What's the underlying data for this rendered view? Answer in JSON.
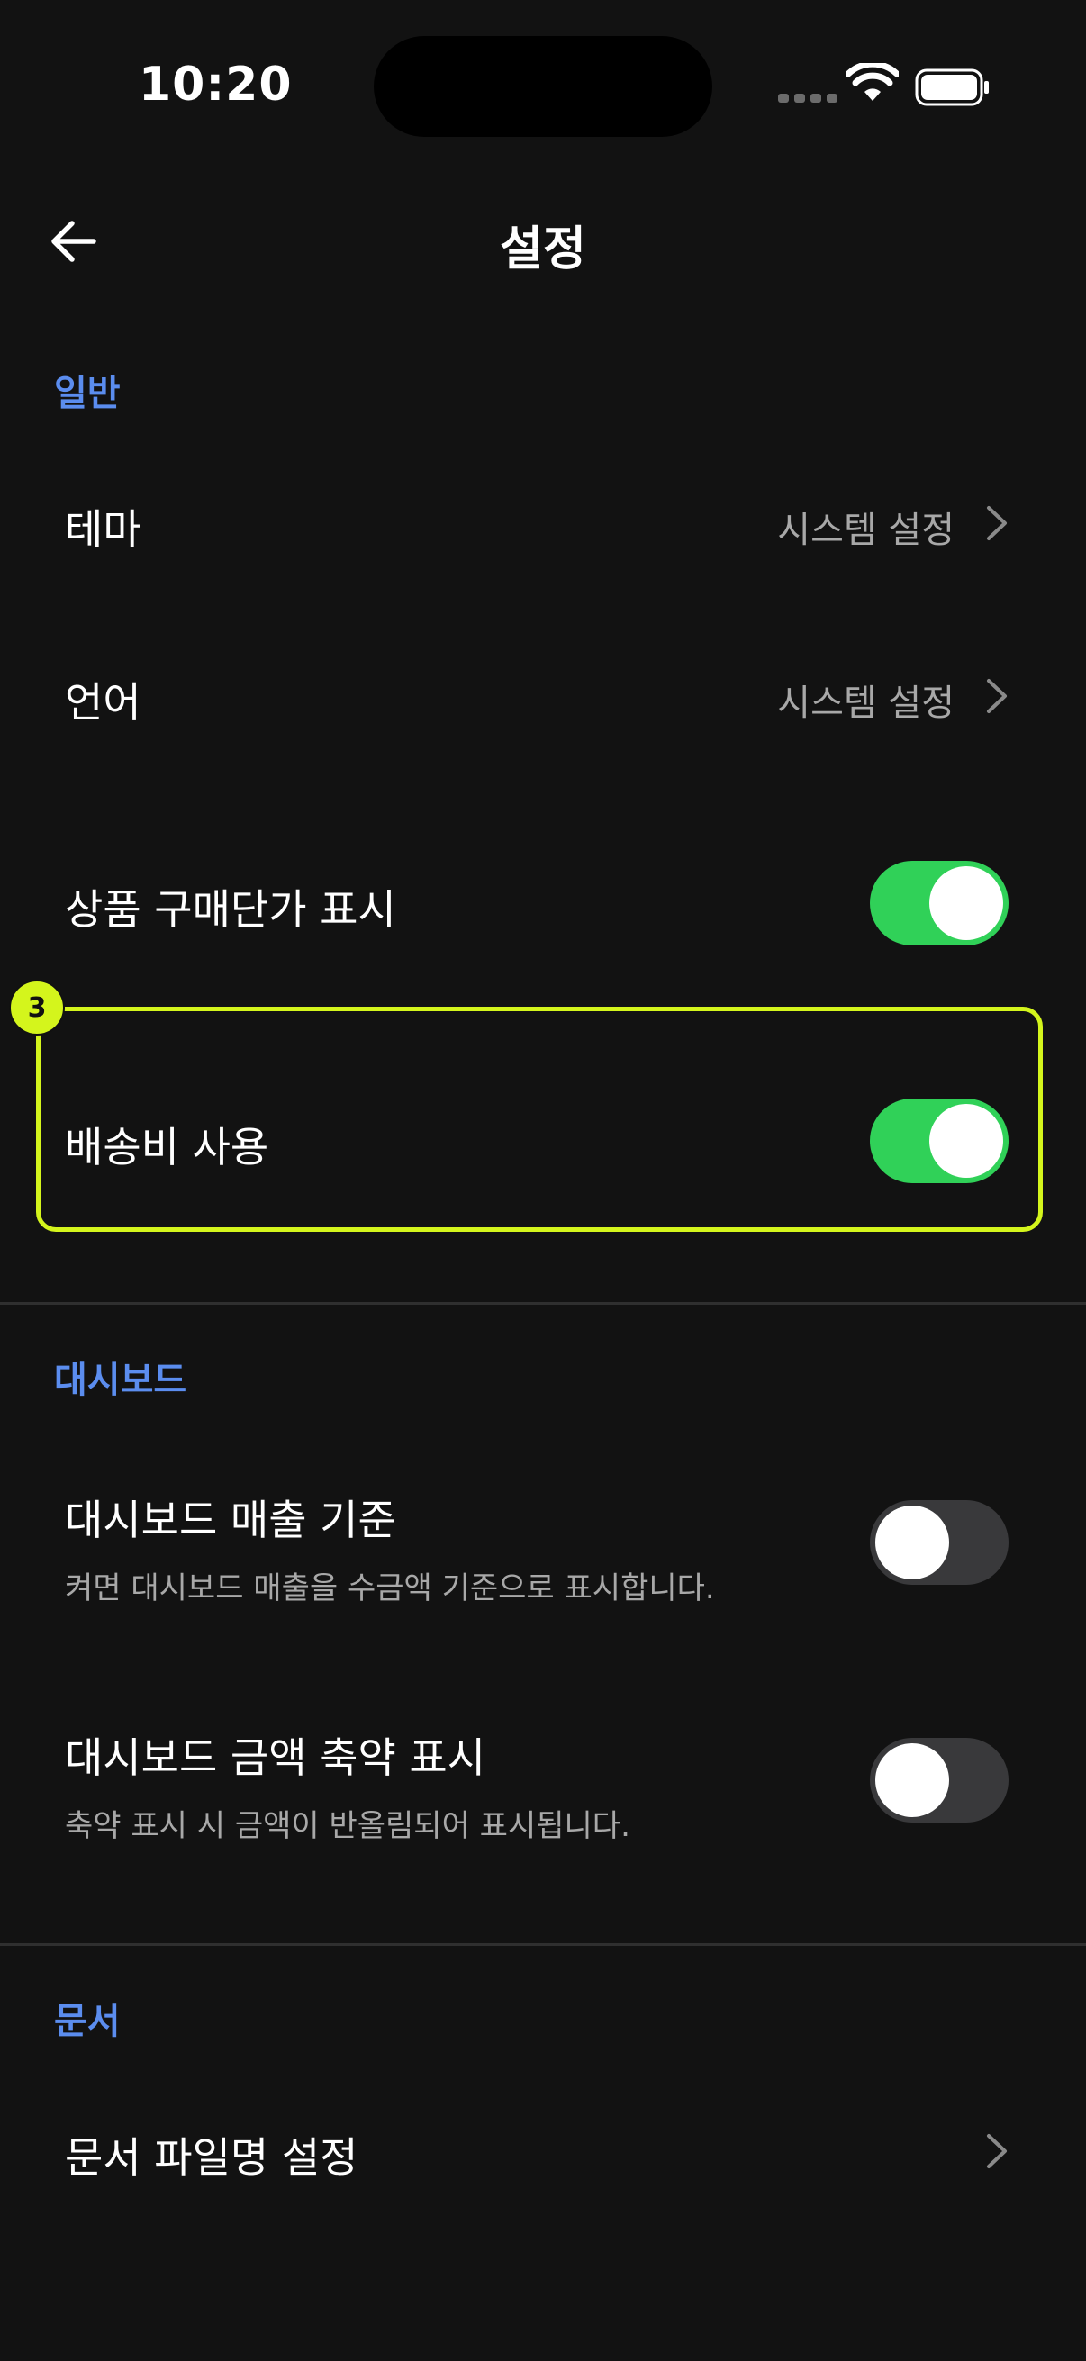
{
  "status_bar": {
    "time": "10:20"
  },
  "header": {
    "title": "설정",
    "back_icon": "arrow-left-icon"
  },
  "sections": {
    "general": {
      "title": "일반",
      "theme": {
        "label": "테마",
        "value": "시스템 설정"
      },
      "language": {
        "label": "언어",
        "value": "시스템 설정"
      },
      "purchase_price": {
        "label": "상품 구매단가 표시",
        "on": true
      },
      "shipping_fee": {
        "label": "배송비 사용",
        "on": true
      }
    },
    "dashboard": {
      "title": "대시보드",
      "sales_basis": {
        "label": "대시보드 매출 기준",
        "description": "켜면 대시보드 매출을 수금액 기준으로 표시합니다.",
        "on": false
      },
      "abbreviate": {
        "label": "대시보드 금액 축약 표시",
        "description": "축약 표시 시 금액이 반올림되어 표시됩니다.",
        "on": false
      }
    },
    "documents": {
      "title": "문서",
      "file_name": {
        "label": "문서 파일명 설정"
      }
    }
  },
  "annotation": {
    "badge": "3"
  },
  "colors": {
    "accent": "#5b8def",
    "toggle_on": "#30d158",
    "toggle_off": "#39393b",
    "highlight": "#d4f51c",
    "background": "#121212"
  }
}
